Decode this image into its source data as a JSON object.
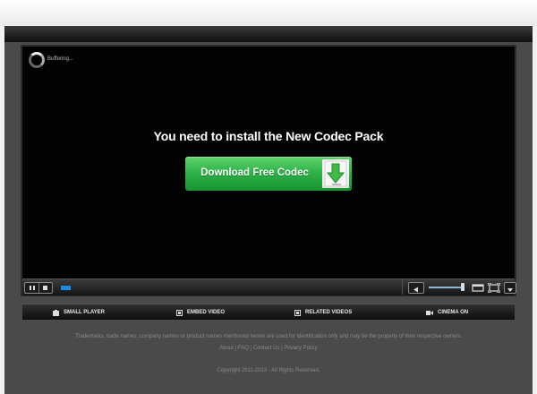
{
  "player": {
    "status_text": "Buffering...",
    "headline": "You need to install the New Codec Pack",
    "download_button_label": "Download Free Codec",
    "playback_progress": 0.03,
    "volume_level": 0.95
  },
  "nav": {
    "items": [
      {
        "label": "SMALL PLAYER",
        "icon": "small-player-icon"
      },
      {
        "label": "EMBED VIDEO",
        "icon": "embed-icon"
      },
      {
        "label": "RELATED VIDEOS",
        "icon": "related-icon"
      },
      {
        "label": "CINEMA ON",
        "icon": "cinema-icon"
      }
    ]
  },
  "footer": {
    "disclaimer": "Trademarks, trade names, company names or product names mentioned herein are used for identification only and may be the property of their respective owners.",
    "links": [
      "About",
      "FAQ",
      "Contact Us",
      "Privacy Policy"
    ],
    "separator": " | ",
    "copyright": "Copyright 2011-2013 - All Rights Reserved."
  },
  "colors": {
    "accent_blue": "#1a8be0",
    "button_green": "#2fb34a"
  }
}
